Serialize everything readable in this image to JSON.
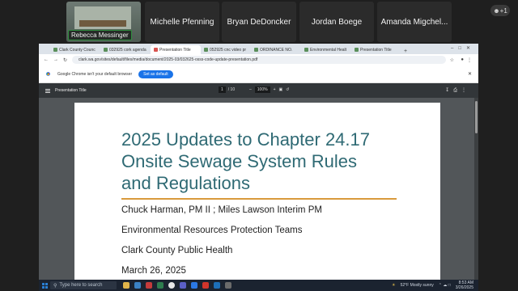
{
  "call": {
    "participants": [
      {
        "name": "Rebecca Messinger"
      },
      {
        "name": "Michelle Pfenning"
      },
      {
        "name": "Bryan DeDoncker"
      },
      {
        "name": "Jordan Boege"
      },
      {
        "name": "Amanda Migchel..."
      }
    ],
    "more_label": "+1"
  },
  "browser": {
    "tabs": [
      {
        "label": "Clark County Counc"
      },
      {
        "label": "032925 cork agenda"
      },
      {
        "label": "Presentation Title"
      },
      {
        "label": "052925 cnc video pr"
      },
      {
        "label": "ORDINANCE NO."
      },
      {
        "label": "Environmental Healt"
      },
      {
        "label": "Presentation Title"
      }
    ],
    "active_tab": 2,
    "url": "clark.wa.gov/sites/default/files/media/document/2025-03/032625-osss-code-update-presentation.pdf",
    "infobar_text": "Google Chrome isn't your default browser",
    "set_default_label": "Set as default"
  },
  "pdf": {
    "doc_title": "Presentation Title",
    "page_current": "1",
    "page_total": "/ 10",
    "zoom": "100%",
    "slide": {
      "title_line1": "2025 Updates to Chapter 24.17",
      "title_line2": "Onsite Sewage System Rules",
      "title_line3": "and Regulations",
      "presenters": "Chuck Harman, PM II ; Miles Lawson Interim PM",
      "team": "Environmental Resources Protection Teams",
      "org": "Clark County Public Health",
      "date": "March 26, 2025"
    }
  },
  "taskbar": {
    "search_placeholder": "Type here to search",
    "weather": "52°F  Mostly sunny",
    "time": "8:53 AM",
    "date": "3/26/2025"
  },
  "colors": {
    "slide_title": "#2f6a74",
    "slide_rule": "#d99a3c",
    "set_default_button": "#1a73e8"
  }
}
